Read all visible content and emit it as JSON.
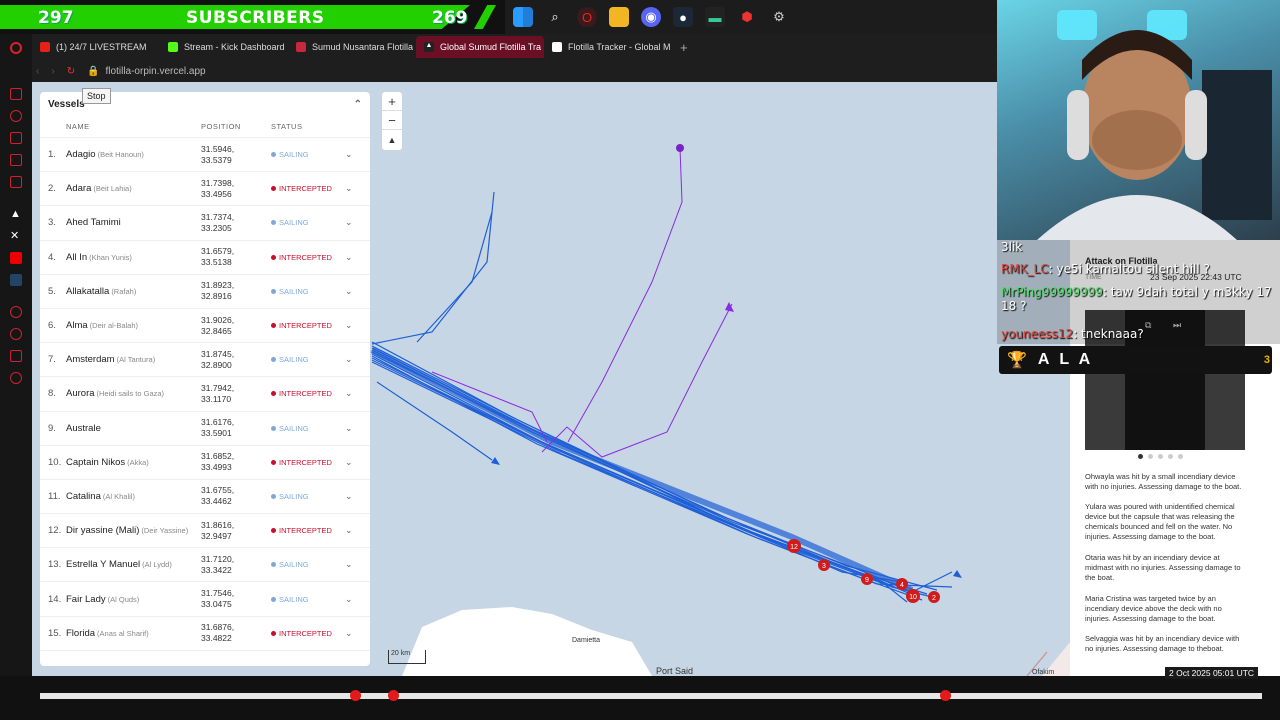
{
  "overlay": {
    "sub_left": "297",
    "sub_title": "SUBSCRIBERS",
    "sub_right": "269"
  },
  "browser": {
    "tabs": [
      {
        "label": "(1) 24/7 LIVESTREAM",
        "color": "#e62117"
      },
      {
        "label": "Stream - Kick Dashboard",
        "color": "#53fc18"
      },
      {
        "label": "Sumud Nusantara Flotilla",
        "color": "#c7283d"
      },
      {
        "label": "Global Sumud Flotilla Tra",
        "color": "#ffffff",
        "active": true
      },
      {
        "label": "Flotilla Tracker - Global M",
        "color": "#ffffff"
      }
    ],
    "new_tab": "+",
    "url": "flotilla-orpin.vercel.app",
    "tooltip": "Stop"
  },
  "panel": {
    "title": "Vessels",
    "col_name": "NAME",
    "col_position": "POSITION",
    "col_status": "STATUS",
    "vessels": [
      {
        "n": "1.",
        "name": "Adagio",
        "sub": "(Beit Hanoun)",
        "lat": "31.5946,",
        "lon": "33.5379",
        "status": "SAILING"
      },
      {
        "n": "2.",
        "name": "Adara",
        "sub": "(Beit Lahia)",
        "lat": "31.7398,",
        "lon": "33.4956",
        "status": "INTERCEPTED"
      },
      {
        "n": "3.",
        "name": "Ahed Tamimi",
        "sub": "",
        "lat": "31.7374,",
        "lon": "33.2305",
        "status": "SAILING"
      },
      {
        "n": "4.",
        "name": "All In",
        "sub": "(Khan Yunis)",
        "lat": "31.6579,",
        "lon": "33.5138",
        "status": "INTERCEPTED"
      },
      {
        "n": "5.",
        "name": "Allakatalla",
        "sub": "(Rafah)",
        "lat": "31.8923,",
        "lon": "32.8916",
        "status": "SAILING"
      },
      {
        "n": "6.",
        "name": "Alma",
        "sub": "(Deir al-Balah)",
        "lat": "31.9026,",
        "lon": "32.8465",
        "status": "INTERCEPTED"
      },
      {
        "n": "7.",
        "name": "Amsterdam",
        "sub": "(Al Tantura)",
        "lat": "31.8745,",
        "lon": "32.8900",
        "status": "SAILING"
      },
      {
        "n": "8.",
        "name": "Aurora",
        "sub": "(Heidi sails to Gaza)",
        "lat": "31.7942,",
        "lon": "33.1170",
        "status": "INTERCEPTED"
      },
      {
        "n": "9.",
        "name": "Australe",
        "sub": "",
        "lat": "31.6176,",
        "lon": "33.5901",
        "status": "SAILING"
      },
      {
        "n": "10.",
        "name": "Captain Nikos",
        "sub": "(Akka)",
        "lat": "31.6852,",
        "lon": "33.4993",
        "status": "INTERCEPTED"
      },
      {
        "n": "11.",
        "name": "Catalina",
        "sub": "(Al Khalil)",
        "lat": "31.6755,",
        "lon": "33.4462",
        "status": "SAILING"
      },
      {
        "n": "12.",
        "name": "Dir yassine (Mali)",
        "sub": "(Deir Yassine)",
        "lat": "31.8616,",
        "lon": "32.9497",
        "status": "INTERCEPTED"
      },
      {
        "n": "13.",
        "name": "Estrella Y Manuel",
        "sub": "(Al Lydd)",
        "lat": "31.7120,",
        "lon": "33.3422",
        "status": "SAILING"
      },
      {
        "n": "14.",
        "name": "Fair Lady",
        "sub": "(Al Quds)",
        "lat": "31.7546,",
        "lon": "33.0475",
        "status": "SAILING"
      },
      {
        "n": "15.",
        "name": "Florida",
        "sub": "(Anas al Sharif)",
        "lat": "31.6876,",
        "lon": "33.4822",
        "status": "INTERCEPTED"
      }
    ]
  },
  "map": {
    "zoom_in": "+",
    "zoom_out": "−",
    "scale": "20 km",
    "city1": "Damietta",
    "city2": "Port Said",
    "city3": "Ofakim"
  },
  "chat": {
    "l1": "3lik",
    "l2_user": "RMK_LC",
    "l2_msg": ": ye5i kamaltou silent hill ?",
    "l3_user": "MrPing99999999",
    "l3_msg": ": taw 9dah total y m3kky 17 18 ?",
    "l4_user": "youneess12",
    "l4_msg": ": tneknaaa?"
  },
  "ala": {
    "name": "A L A",
    "count": "3"
  },
  "right_panel": {
    "title": "Attack on Flotilla",
    "time_label": "TIME",
    "time": "23 Sep 2025 22:43 UTC",
    "stories": [
      "Ohwayla was hit by a small incendiary device with no injuries. Assessing damage to the boat.",
      "Yulara was poured with unidentified chemical device but the capsule that was releasing the chemicals bounced and fell on the water. No injuries. Assessing damage to the boat.",
      "Otaria was hit by an incendiary device at midmast with no injuries. Assessing damage to the boat.",
      "Maria Cristina was targeted twice by an incendiary device above the deck with no injuries. Assessing damage to the boat.",
      "Selvaggia was hit by an incendiary device with no injuries. Assessing damage to theboat."
    ]
  },
  "timeline": {
    "date": "2 Oct 2025 05:01 UTC"
  }
}
